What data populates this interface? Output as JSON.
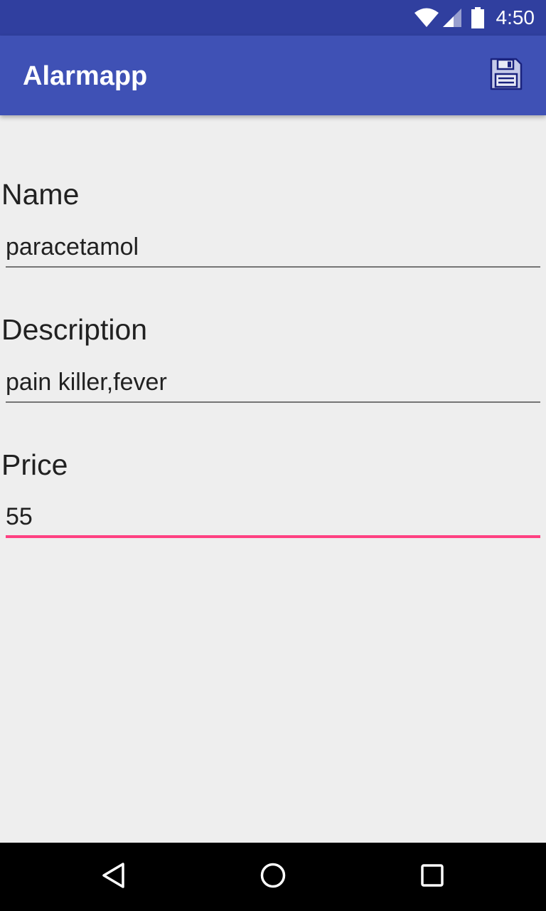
{
  "status_bar": {
    "time": "4:50",
    "icons": [
      "wifi-icon",
      "signal-icon",
      "battery-icon"
    ]
  },
  "app_bar": {
    "title": "Alarmapp",
    "action_icon": "save-icon"
  },
  "form": {
    "name": {
      "label": "Name",
      "value": "paracetamol"
    },
    "description": {
      "label": "Description",
      "value": "pain killer,fever"
    },
    "price": {
      "label": "Price",
      "value": "55"
    }
  },
  "navigation_bar": {
    "buttons": [
      "back-icon",
      "home-icon",
      "recents-icon"
    ]
  },
  "colors": {
    "primary": "#3f51b5",
    "primary_dark": "#303f9f",
    "accent": "#ff4081",
    "background": "#eeeeee"
  }
}
